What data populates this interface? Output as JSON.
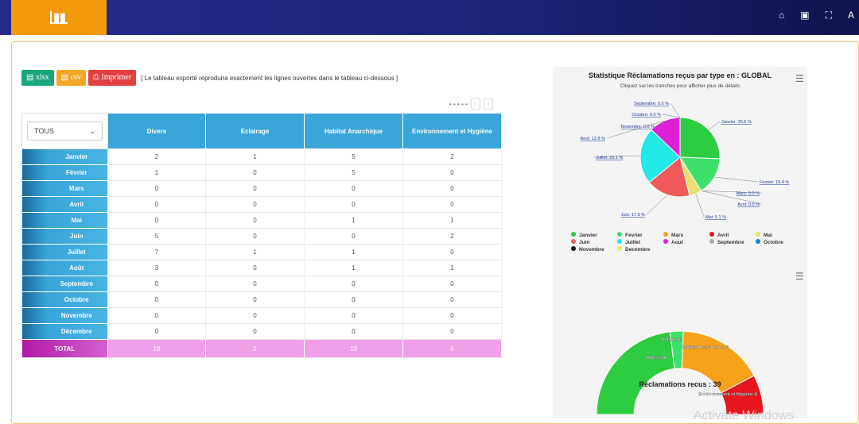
{
  "header": {
    "logo_icon": "bar-chart-icon",
    "icons": [
      "home-icon",
      "book-icon",
      "fullscreen-icon"
    ],
    "right_text": "A"
  },
  "toolbar": {
    "xlsx_label": "xlsx",
    "csv_label": "csv",
    "print_label": "Imprimer",
    "note": "[ Le tableau exporté reproduira exactement les lignes ouvertes dans le tableau ci-dessous ]"
  },
  "pager": {
    "dots": "• • • • •",
    "prev": "‹",
    "next": "›"
  },
  "table": {
    "filter_value": "TOUS",
    "columns": [
      "Divers",
      "Eclairage",
      "Habitat Anarchique",
      "Environnement et Hygiène"
    ],
    "rows": [
      {
        "month": "Janvier",
        "values": [
          "2",
          "1",
          "5",
          "2"
        ]
      },
      {
        "month": "Février",
        "values": [
          "1",
          "0",
          "5",
          "0"
        ]
      },
      {
        "month": "Mars",
        "values": [
          "0",
          "0",
          "0",
          "0"
        ]
      },
      {
        "month": "Avril",
        "values": [
          "0",
          "0",
          "0",
          "0"
        ]
      },
      {
        "month": "Mai",
        "values": [
          "0",
          "0",
          "1",
          "1"
        ]
      },
      {
        "month": "Juin",
        "values": [
          "5",
          "0",
          "0",
          "2"
        ]
      },
      {
        "month": "Juillet",
        "values": [
          "7",
          "1",
          "1",
          "0"
        ]
      },
      {
        "month": "Août",
        "values": [
          "3",
          "0",
          "1",
          "1"
        ]
      },
      {
        "month": "Septembre",
        "values": [
          "0",
          "0",
          "0",
          "0"
        ]
      },
      {
        "month": "Octobre",
        "values": [
          "0",
          "0",
          "0",
          "0"
        ]
      },
      {
        "month": "Novembre",
        "values": [
          "0",
          "0",
          "0",
          "0"
        ]
      },
      {
        "month": "Décembre",
        "values": [
          "0",
          "0",
          "0",
          "0"
        ]
      }
    ],
    "total": {
      "label": "TOTAL",
      "values": [
        "18",
        "2",
        "13",
        "6"
      ]
    }
  },
  "chart_data": [
    {
      "type": "pie",
      "title": "Statistique Réclamations reçus par type en : GLOBAL",
      "subtitle": "Cliquez sur les tranches pour afficher plus de détails",
      "slices": [
        {
          "name": "Janvier",
          "value": 25.6,
          "label": "Janvier: 25.6 %",
          "color": "#2ecc40"
        },
        {
          "name": "Fevrier",
          "value": 15.4,
          "label": "Fevrier: 15.4 %",
          "color": "#3de06a"
        },
        {
          "name": "Mars",
          "value": 0.0,
          "label": "Mars: 0.0 %",
          "color": "#f7a21b"
        },
        {
          "name": "Avril",
          "value": 0.0,
          "label": "Avril: 0.0 %",
          "color": "#e8141e"
        },
        {
          "name": "Mai",
          "value": 5.1,
          "label": "Mai: 5.1 %",
          "color": "#e8e070"
        },
        {
          "name": "Juin",
          "value": 17.9,
          "label": "Juin: 17.9 %",
          "color": "#f05a5a"
        },
        {
          "name": "Juillet",
          "value": 23.1,
          "label": "Juillet: 23.1 %",
          "color": "#22e8e8"
        },
        {
          "name": "Aout",
          "value": 12.8,
          "label": "Aout: 12.8 %",
          "color": "#e01fd8"
        },
        {
          "name": "Septembre",
          "value": 0.0,
          "label": "Septembre: 0.0 %",
          "color": "#aaaaaa"
        },
        {
          "name": "Octobre",
          "value": 0.0,
          "label": "Octobre: 0.0 %",
          "color": "#1e7fbf"
        },
        {
          "name": "Novembre",
          "value": 0.0,
          "label": "Novembre: 0.0 %",
          "color": "#111111"
        },
        {
          "name": "Decembre",
          "value": 0.0,
          "label": "Decembre",
          "color": "#f0ee60"
        }
      ],
      "legend": [
        "Janvier",
        "Fevrier",
        "Mars",
        "Avril",
        "Mai",
        "Juin",
        "Juillet",
        "Aout",
        "Septembre",
        "Octobre",
        "Novembre",
        "Decembre"
      ],
      "legend_position": "bottom"
    },
    {
      "type": "pie",
      "subtype": "semi-donut",
      "center_label": "Réclamations recus : 39",
      "slices": [
        {
          "name": "Divers",
          "value": 18,
          "label": "Divers:18",
          "color": "#2ecc40"
        },
        {
          "name": "Eclairage",
          "value": 2,
          "label": "Eclairage:2",
          "color": "#3de06a"
        },
        {
          "name": "Habitat Anarchique",
          "value": 13,
          "label": "Habitat Anarchique:13",
          "color": "#f7a21b"
        },
        {
          "name": "Environnement et Hygiène",
          "value": 6,
          "label": "Environnement et Hygiène:6",
          "color": "#e8141e"
        }
      ]
    }
  ],
  "watermark": "Activate Windows"
}
